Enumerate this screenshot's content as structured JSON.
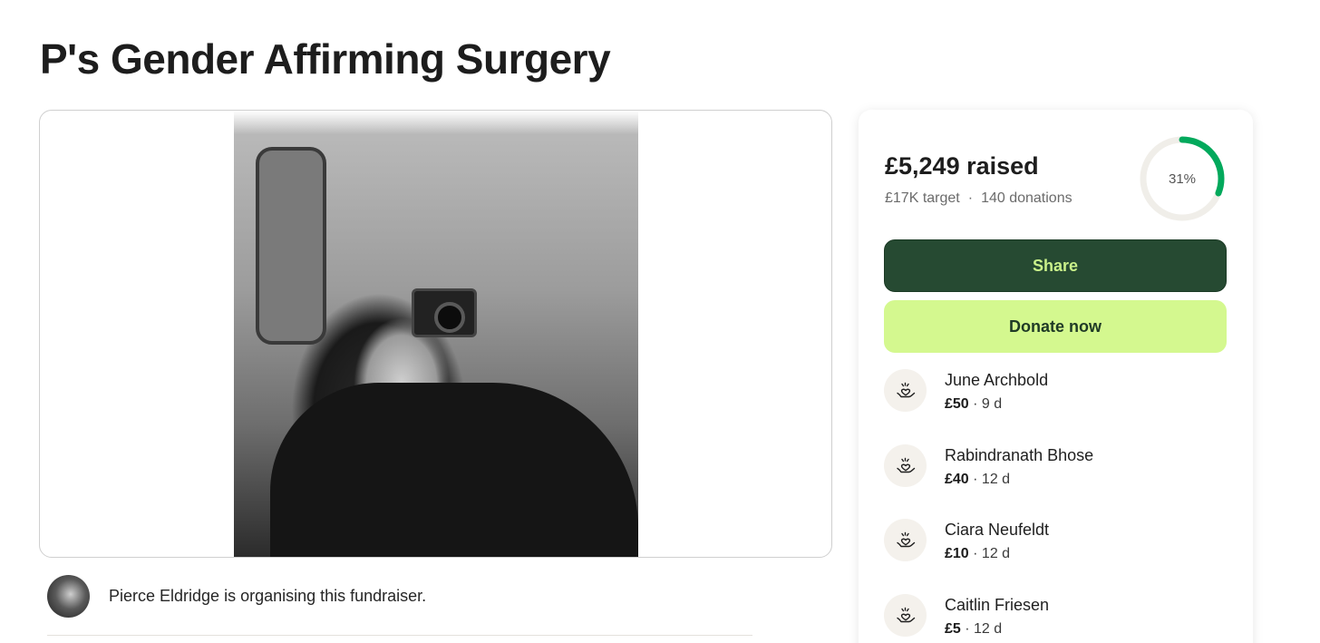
{
  "page": {
    "title": "P's Gender Affirming Surgery"
  },
  "organiser": {
    "text": "Pierce Eldridge is organising this fundraiser."
  },
  "summary": {
    "raised": "£5,249 raised",
    "target": "£17K target",
    "separator": "·",
    "donations": "140 donations",
    "progress_percent": 31,
    "progress_label": "31%"
  },
  "actions": {
    "share_label": "Share",
    "donate_label": "Donate now"
  },
  "donors": [
    {
      "name": "June Archbold",
      "amount": "£50",
      "sep": " · ",
      "time": "9 d"
    },
    {
      "name": "Rabindranath Bhose",
      "amount": "£40",
      "sep": " · ",
      "time": "12 d"
    },
    {
      "name": "Ciara Neufeldt",
      "amount": "£10",
      "sep": " · ",
      "time": "12 d"
    },
    {
      "name": "Caitlin Friesen",
      "amount": "£5",
      "sep": " · ",
      "time": "12 d"
    }
  ],
  "colors": {
    "share_bg": "#264a32",
    "share_text": "#c9f08a",
    "donate_bg": "#d4f88f",
    "progress": "#02a95c",
    "progress_track": "#f0eee9"
  },
  "icons": {
    "donor": "heart-hand-icon"
  }
}
